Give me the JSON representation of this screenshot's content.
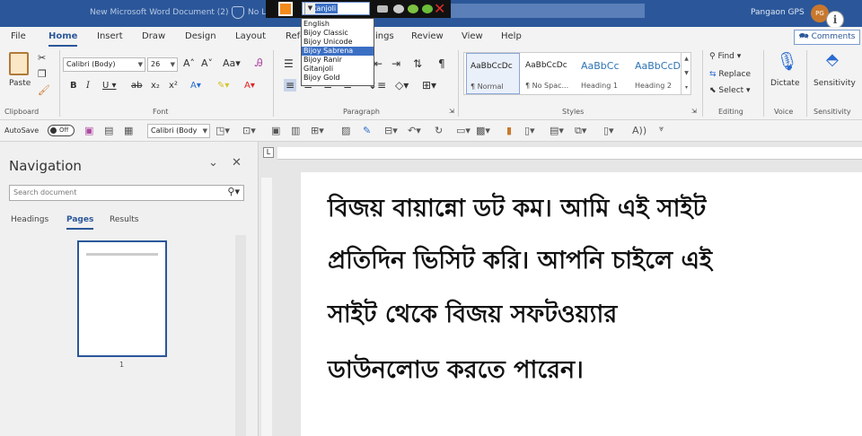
{
  "titlebar": {
    "doc_title": "New Microsoft Word Document (2)",
    "nol": "No L",
    "user_name": "Pangaon GPS",
    "avatar": "PG",
    "info": "i"
  },
  "bijoy": {
    "selected_font": "Gitanjoli",
    "fonts": [
      "English",
      "Bijoy Classic",
      "Bijoy Unicode",
      "Bijoy Sabrena",
      "Bijoy Ranir",
      "Gitanjoli",
      "Bijoy Gold"
    ],
    "selected_index": 3
  },
  "tabs": [
    "File",
    "Home",
    "Insert",
    "Draw",
    "Design",
    "Layout",
    "Refe",
    "ings",
    "Review",
    "View",
    "Help"
  ],
  "comments": "Comments",
  "ribbon": {
    "paste": "Paste",
    "clipboard": "Clipboard",
    "font_name": "Calibri (Body)",
    "font_size": "26",
    "font": "Font",
    "paragraph": "Paragraph",
    "styles": [
      {
        "preview": "AaBbCcDc",
        "name": "¶ Normal"
      },
      {
        "preview": "AaBbCcDc",
        "name": "¶ No Spac..."
      },
      {
        "preview": "AaBbCc",
        "name": "Heading 1"
      },
      {
        "preview": "AaBbCcD",
        "name": "Heading 2"
      }
    ],
    "styles_label": "Styles",
    "find": "Find",
    "replace": "Replace",
    "select": "Select",
    "editing": "Editing",
    "dictate": "Dictate",
    "voice": "Voice",
    "sensitivity": "Sensitivity"
  },
  "qat": {
    "autosave": "AutoSave",
    "toggle": "Off",
    "font_name": "Calibri (Body"
  },
  "nav": {
    "title": "Navigation",
    "search_placeholder": "Search document",
    "tabs": [
      "Headings",
      "Pages",
      "Results"
    ],
    "page_number": "1"
  },
  "document": {
    "lines": [
      "বিজয় বায়ান্নো ডট কম। আমি এই সাইট",
      "প্রতিদিন ভিসিট করি। আপনি চাইলে এই",
      "সাইট থেকে বিজয় সফটওয়্যার",
      "ডাউনলোড করতে পারেন।"
    ]
  }
}
